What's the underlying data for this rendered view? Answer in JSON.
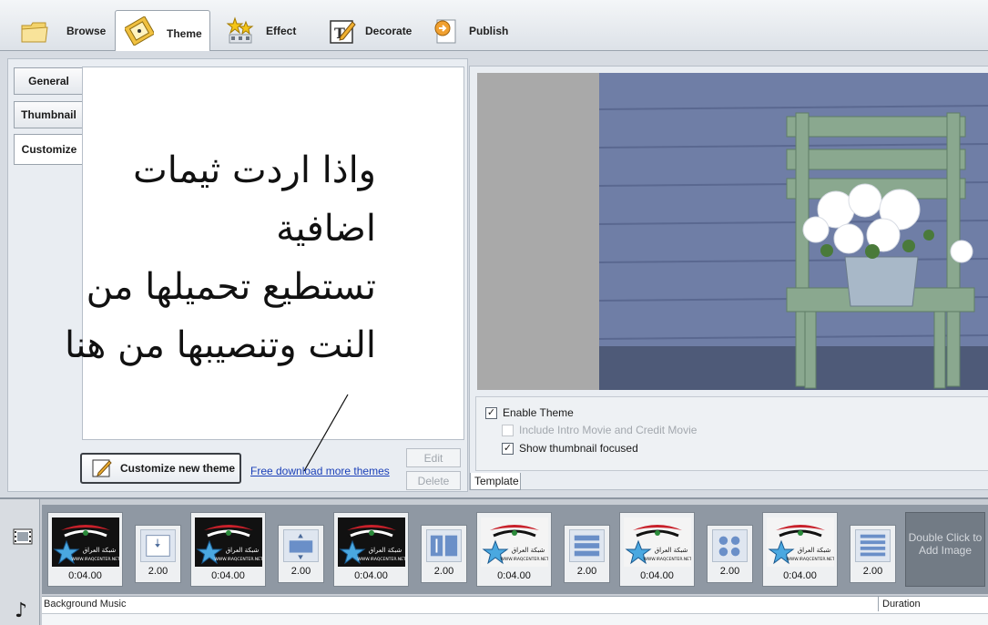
{
  "toptabs": [
    {
      "label": "Browse",
      "icon": "folder-icon"
    },
    {
      "label": "Theme",
      "icon": "film-icon"
    },
    {
      "label": "Effect",
      "icon": "stars-icon"
    },
    {
      "label": "Decorate",
      "icon": "pencil-frame-icon"
    },
    {
      "label": "Publish",
      "icon": "publish-arrow-icon"
    }
  ],
  "sidetabs": [
    "General",
    "Thumbnail",
    "Customize"
  ],
  "annotation_lines": [
    "واذا اردت ثيمات",
    "اضافية",
    "تستطيع تحميلها من",
    "النت وتنصيبها من هنا"
  ],
  "buttons": {
    "customize": "Customize new theme",
    "download_link": "Free download more themes",
    "edit": "Edit",
    "delete": "Delete"
  },
  "options": {
    "enable_theme": {
      "label": "Enable Theme",
      "checked": true
    },
    "include_intro": {
      "label": "Include Intro Movie and Credit Movie",
      "checked": false,
      "disabled": true
    },
    "show_thumbnail": {
      "label": "Show thumbnail focused",
      "checked": true
    }
  },
  "template_tab": "Template",
  "timeline": {
    "clips": [
      {
        "duration": "0:04.00",
        "variant": "dark"
      },
      {
        "duration": "0:04.00",
        "variant": "dark"
      },
      {
        "duration": "0:04.00",
        "variant": "dark"
      },
      {
        "duration": "0:04.00",
        "variant": "light"
      },
      {
        "duration": "0:04.00",
        "variant": "light"
      },
      {
        "duration": "0:04.00",
        "variant": "light"
      }
    ],
    "transitions": [
      "2.00",
      "2.00",
      "2.00",
      "2.00",
      "2.00",
      "2.00"
    ],
    "add_image": "Double Click to Add Image",
    "background_music": "Background Music",
    "duration_header": "Duration",
    "logo_text_ar": "شبكة العراق",
    "logo_text_en": "WWW.IRAQCENTER.NET"
  },
  "colors": {
    "link": "#1a3fb8",
    "wall": "#6f7ea6",
    "chair": "#8aa88f",
    "logo_red": "#c8202a"
  }
}
